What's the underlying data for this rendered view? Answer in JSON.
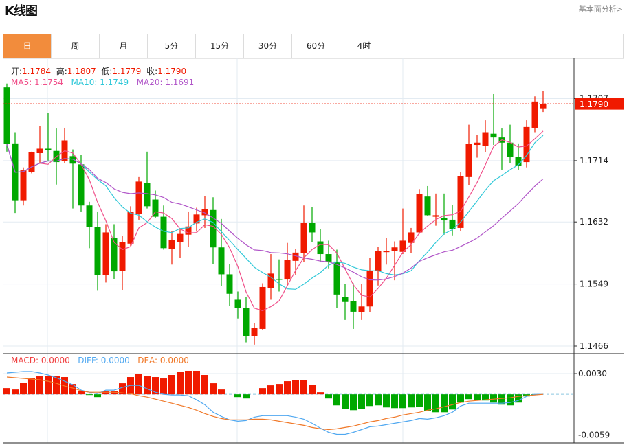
{
  "header": {
    "title": "K线图",
    "link": "基本面分析>"
  },
  "tabs": [
    {
      "label": "日",
      "active": true
    },
    {
      "label": "周",
      "active": false
    },
    {
      "label": "月",
      "active": false
    },
    {
      "label": "5分",
      "active": false
    },
    {
      "label": "15分",
      "active": false
    },
    {
      "label": "30分",
      "active": false
    },
    {
      "label": "60分",
      "active": false
    },
    {
      "label": "4时",
      "active": false
    }
  ],
  "ohlc_info": {
    "open_label": "开:",
    "open": "1.1784",
    "high_label": "高:",
    "high": "1.1807",
    "low_label": "低:",
    "low": "1.1779",
    "close_label": "收:",
    "close": "1.1790"
  },
  "ma_info": {
    "ma5": "MA5: 1.1754",
    "ma10": "MA10: 1.1749",
    "ma20": "MA20: 1.1691"
  },
  "macd_info": {
    "macd": "MACD: 0.0000",
    "diff": "DIFF: 0.0000",
    "dea": "DEA: 0.0000"
  },
  "colors": {
    "up": "#f01a00",
    "down": "#00a800",
    "ma5": "#f0508a",
    "ma10": "#30c8d8",
    "ma20": "#b054c8",
    "macd": "#f04040",
    "diff": "#50a8f0",
    "dea": "#f07828",
    "active_tab": "#f28c3c"
  },
  "chart_data": [
    {
      "type": "candlestick",
      "price_axis": {
        "ticks": [
          "1.1797",
          "1.1714",
          "1.1632",
          "1.1549",
          "1.1466"
        ],
        "range": [
          1.1466,
          1.1797
        ]
      },
      "last_price": "1.1790",
      "moving_averages": [
        5,
        10,
        20
      ],
      "ohlc": [
        [
          1.1812,
          1.1817,
          1.1726,
          1.1736
        ],
        [
          1.1737,
          1.1752,
          1.1644,
          1.1661
        ],
        [
          1.1661,
          1.1705,
          1.1654,
          1.1701
        ],
        [
          1.1699,
          1.1726,
          1.1697,
          1.1725
        ],
        [
          1.1724,
          1.176,
          1.171,
          1.173
        ],
        [
          1.173,
          1.1778,
          1.1714,
          1.1728
        ],
        [
          1.1727,
          1.1757,
          1.1682,
          1.1712
        ],
        [
          1.1713,
          1.1758,
          1.1711,
          1.1741
        ],
        [
          1.172,
          1.1729,
          1.165,
          1.171
        ],
        [
          1.1709,
          1.1722,
          1.1646,
          1.1654
        ],
        [
          1.1654,
          1.1659,
          1.1597,
          1.1625
        ],
        [
          1.1625,
          1.1646,
          1.154,
          1.1561
        ],
        [
          1.1561,
          1.1629,
          1.1551,
          1.1618
        ],
        [
          1.1611,
          1.1629,
          1.1556,
          1.1566
        ],
        [
          1.1567,
          1.1613,
          1.1541,
          1.1605
        ],
        [
          1.1603,
          1.1653,
          1.16,
          1.1645
        ],
        [
          1.1643,
          1.1692,
          1.1635,
          1.1686
        ],
        [
          1.1684,
          1.1726,
          1.165,
          1.1653
        ],
        [
          1.1662,
          1.1674,
          1.1637,
          1.1639
        ],
        [
          1.1639,
          1.1654,
          1.1595,
          1.1597
        ],
        [
          1.1596,
          1.162,
          1.1575,
          1.1608
        ],
        [
          1.1605,
          1.1622,
          1.1584,
          1.1616
        ],
        [
          1.1615,
          1.1646,
          1.1599,
          1.1626
        ],
        [
          1.163,
          1.1651,
          1.1619,
          1.1642
        ],
        [
          1.1641,
          1.1667,
          1.1624,
          1.1649
        ],
        [
          1.1648,
          1.1665,
          1.1576,
          1.1598
        ],
        [
          1.1598,
          1.1636,
          1.1546,
          1.1562
        ],
        [
          1.1562,
          1.1576,
          1.152,
          1.1536
        ],
        [
          1.1528,
          1.1539,
          1.1503,
          1.1517
        ],
        [
          1.1517,
          1.1532,
          1.1471,
          1.1479
        ],
        [
          1.1479,
          1.1497,
          1.1468,
          1.149
        ],
        [
          1.1489,
          1.155,
          1.1488,
          1.1545
        ],
        [
          1.1544,
          1.1589,
          1.1528,
          1.1563
        ],
        [
          1.1556,
          1.1582,
          1.1539,
          1.1555
        ],
        [
          1.1555,
          1.1604,
          1.1547,
          1.1581
        ],
        [
          1.158,
          1.1596,
          1.1561,
          1.1591
        ],
        [
          1.159,
          1.1654,
          1.1578,
          1.1631
        ],
        [
          1.1631,
          1.1652,
          1.1605,
          1.1618
        ],
        [
          1.1606,
          1.1623,
          1.1579,
          1.1589
        ],
        [
          1.1589,
          1.1607,
          1.157,
          1.1579
        ],
        [
          1.1579,
          1.1595,
          1.1517,
          1.1535
        ],
        [
          1.1532,
          1.1549,
          1.1501,
          1.1525
        ],
        [
          1.1526,
          1.155,
          1.1489,
          1.1512
        ],
        [
          1.1511,
          1.1549,
          1.1501,
          1.1519
        ],
        [
          1.1519,
          1.1584,
          1.1511,
          1.1567
        ],
        [
          1.1567,
          1.1599,
          1.1547,
          1.1593
        ],
        [
          1.1592,
          1.1611,
          1.1575,
          1.1593
        ],
        [
          1.1593,
          1.1606,
          1.1554,
          1.1598
        ],
        [
          1.1592,
          1.165,
          1.1589,
          1.1607
        ],
        [
          1.1604,
          1.1624,
          1.159,
          1.1618
        ],
        [
          1.1618,
          1.1676,
          1.1616,
          1.1669
        ],
        [
          1.1666,
          1.168,
          1.164,
          1.1641
        ],
        [
          1.1639,
          1.167,
          1.1627,
          1.1641
        ],
        [
          1.1637,
          1.167,
          1.1615,
          1.1634
        ],
        [
          1.1635,
          1.1655,
          1.1614,
          1.1623
        ],
        [
          1.1624,
          1.1699,
          1.162,
          1.1693
        ],
        [
          1.1692,
          1.1762,
          1.1681,
          1.1736
        ],
        [
          1.1735,
          1.1748,
          1.1718,
          1.1738
        ],
        [
          1.1734,
          1.1768,
          1.1725,
          1.1752
        ],
        [
          1.175,
          1.1803,
          1.1735,
          1.1745
        ],
        [
          1.1745,
          1.1757,
          1.1702,
          1.1738
        ],
        [
          1.1738,
          1.1762,
          1.1711,
          1.1719
        ],
        [
          1.1719,
          1.1737,
          1.1702,
          1.1707
        ],
        [
          1.1712,
          1.1768,
          1.1705,
          1.1759
        ],
        [
          1.1758,
          1.18,
          1.1752,
          1.1793
        ],
        [
          1.1784,
          1.1807,
          1.1779,
          1.179
        ]
      ]
    },
    {
      "type": "bar+line",
      "axis": {
        "ticks": [
          "0.0030",
          "-0.0059"
        ],
        "range": [
          -0.0059,
          0.003
        ]
      },
      "macd": [
        0.0009,
        0.0007,
        0.0017,
        0.0024,
        0.0026,
        0.0027,
        0.0026,
        0.0025,
        0.0015,
        0.0005,
        -0.0001,
        -0.0004,
        0.0005,
        0.0005,
        0.0016,
        0.0025,
        0.0029,
        0.0026,
        0.0025,
        0.0023,
        0.0028,
        0.0032,
        0.0034,
        0.0034,
        0.0028,
        0.0016,
        0.0007,
        0.0,
        -0.0004,
        -0.0006,
        0.0,
        0.0009,
        0.0013,
        0.0015,
        0.0019,
        0.0021,
        0.0021,
        0.0014,
        0.0003,
        -0.0006,
        -0.0016,
        -0.0021,
        -0.0023,
        -0.0021,
        -0.0017,
        -0.0016,
        -0.0019,
        -0.002,
        -0.002,
        -0.0019,
        -0.0018,
        -0.0024,
        -0.0026,
        -0.0026,
        -0.0022,
        -0.0012,
        -0.0007,
        -0.0008,
        -0.0009,
        -0.0012,
        -0.0015,
        -0.0016,
        -0.0012,
        -0.0003,
        -0.0001,
        0.0
      ],
      "diff": [
        0.0031,
        0.0032,
        0.0033,
        0.0033,
        0.0031,
        0.0028,
        0.0024,
        0.0019,
        0.0014,
        0.0006,
        0.0003,
        0.0001,
        0.0006,
        0.0006,
        0.001,
        0.0013,
        0.0013,
        0.0008,
        0.0003,
        0.0,
        -0.0001,
        -0.0001,
        -0.0002,
        -0.0008,
        -0.0015,
        -0.0026,
        -0.0032,
        -0.0037,
        -0.0039,
        -0.0038,
        -0.0033,
        -0.0031,
        -0.0031,
        -0.0031,
        -0.0031,
        -0.0033,
        -0.0036,
        -0.0042,
        -0.0049,
        -0.0055,
        -0.0058,
        -0.0058,
        -0.0055,
        -0.0051,
        -0.0047,
        -0.0046,
        -0.0044,
        -0.0042,
        -0.004,
        -0.0038,
        -0.0035,
        -0.0036,
        -0.0034,
        -0.0031,
        -0.0026,
        -0.0017,
        -0.0013,
        -0.0013,
        -0.0013,
        -0.0013,
        -0.0013,
        -0.0012,
        -0.0009,
        -0.0003,
        0.0,
        0.0
      ],
      "dea": [
        0.0025,
        0.0024,
        0.0023,
        0.0022,
        0.0021,
        0.0019,
        0.0016,
        0.0012,
        0.0009,
        0.0005,
        0.0003,
        0.0003,
        0.0003,
        0.0003,
        0.0002,
        0.0001,
        -0.0002,
        -0.0004,
        -0.0007,
        -0.001,
        -0.0013,
        -0.0016,
        -0.0019,
        -0.0023,
        -0.0028,
        -0.0032,
        -0.0035,
        -0.0037,
        -0.0037,
        -0.0037,
        -0.0036,
        -0.0036,
        -0.0037,
        -0.0039,
        -0.0041,
        -0.0043,
        -0.0045,
        -0.0048,
        -0.005,
        -0.0051,
        -0.005,
        -0.0048,
        -0.0046,
        -0.0043,
        -0.004,
        -0.0038,
        -0.0035,
        -0.0033,
        -0.003,
        -0.0028,
        -0.0026,
        -0.0023,
        -0.0021,
        -0.0018,
        -0.0015,
        -0.0012,
        -0.001,
        -0.0009,
        -0.0008,
        -0.0007,
        -0.0006,
        -0.0005,
        -0.0003,
        -0.0002,
        -0.0001,
        0.0
      ]
    }
  ]
}
